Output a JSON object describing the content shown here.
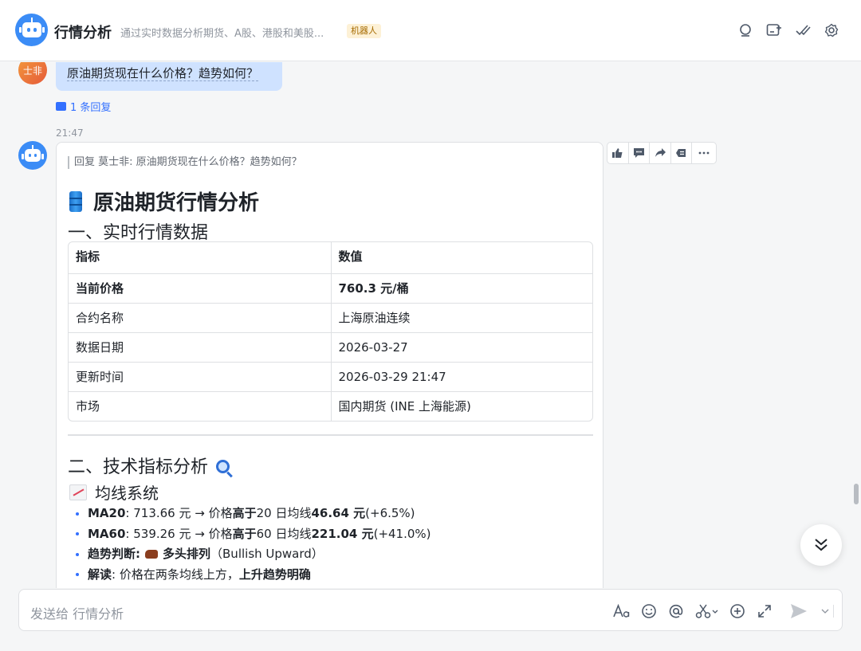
{
  "header": {
    "title": "行情分析",
    "subtitle": "通过实时数据分析期货、A股、港股和美股...",
    "tag": "机器人",
    "icons": [
      "search-icon",
      "add-chat-icon",
      "done-icon",
      "settings-icon"
    ]
  },
  "user_message": {
    "avatar_text": "士非",
    "text": "原油期货现在什么价格？趋势如何？",
    "reply_link": "1 条回复"
  },
  "bot_message": {
    "timestamp": "21:47",
    "quote": "回复 莫士非: 原油期货现在什么价格？趋势如何？",
    "heading": "原油期货行情分析",
    "section1_title": "一、实时行情数据",
    "table": {
      "headers": [
        "指标",
        "数值"
      ],
      "rows": [
        {
          "label": "当前价格",
          "value": "760.3 元/桶",
          "bold": true
        },
        {
          "label": "合约名称",
          "value": "上海原油连续"
        },
        {
          "label": "数据日期",
          "value": "2026-03-27"
        },
        {
          "label": "更新时间",
          "value": "2026-03-29 21:47"
        },
        {
          "label": "市场",
          "value": "国内期货 (INE 上海能源)"
        }
      ]
    },
    "section2_title": "二、技术指标分析",
    "subsection_title": "均线系统",
    "bullets": [
      {
        "label": "MA20",
        "text": ": 713.66 元 → 价格",
        "strong1": "高于",
        "text2": "20 日均线 ",
        "strong2": "46.64 元",
        "text3": " (+6.5%)"
      },
      {
        "label": "MA60",
        "text": ": 539.26 元 → 价格",
        "strong1": "高于",
        "text2": "60 日均线 ",
        "strong2": "221.04 元",
        "text3": " (+41.0%)"
      },
      {
        "label": "趋势判断:",
        "strong2": "多头排列",
        "text3": "（Bullish Upward）"
      },
      {
        "label": "解读",
        "text": ": 价格在两条均线上方，",
        "strong2": "上升趋势明确"
      }
    ]
  },
  "message_toolbar": [
    "thumbs-up-icon",
    "comment-icon",
    "forward-icon",
    "pin-icon",
    "more-icon"
  ],
  "composer": {
    "placeholder": "发送给 行情分析",
    "icons": [
      "font-icon",
      "emoji-icon",
      "mention-icon",
      "scissors-icon",
      "add-icon",
      "expand-icon",
      "send-icon",
      "chevron-down-icon"
    ]
  }
}
